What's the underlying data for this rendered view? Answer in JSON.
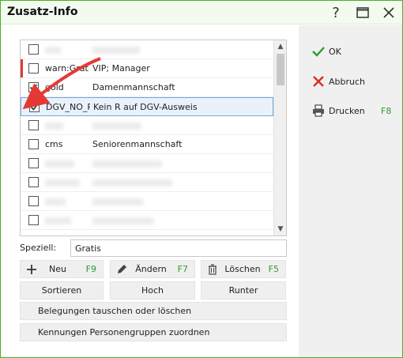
{
  "window": {
    "title": "Zusatz-Info",
    "title_buttons": [
      {
        "name": "help-icon",
        "glyph": "?"
      },
      {
        "name": "maximize-icon",
        "glyph": "☐"
      },
      {
        "name": "close-icon",
        "glyph": "✕"
      }
    ]
  },
  "list": {
    "rows": [
      {
        "checked": false,
        "code": "",
        "desc": "",
        "blurred": true
      },
      {
        "checked": false,
        "code": "warn:Gratis",
        "desc": "VIP; Manager",
        "blurred": false,
        "redmark": true
      },
      {
        "checked": true,
        "code": "gold",
        "desc": "Damenmannschaft",
        "blurred": false
      },
      {
        "checked": true,
        "code": "DGV_NO_R",
        "desc": "Kein R auf DGV-Ausweis",
        "blurred": false,
        "selected": true
      },
      {
        "checked": false,
        "code": "",
        "desc": "",
        "blurred": true
      },
      {
        "checked": false,
        "code": "cms",
        "desc": "Seniorenmannschaft",
        "blurred": false
      },
      {
        "checked": false,
        "code": "",
        "desc": "",
        "blurred": true
      },
      {
        "checked": false,
        "code": "",
        "desc": "",
        "blurred": true
      },
      {
        "checked": false,
        "code": "",
        "desc": "",
        "blurred": true
      },
      {
        "checked": false,
        "code": "",
        "desc": "",
        "blurred": true
      }
    ]
  },
  "speziell": {
    "label": "Speziell:",
    "value": "Gratis"
  },
  "buttons": {
    "neu": {
      "label": "Neu",
      "key": "F9"
    },
    "aendern": {
      "label": "Ändern",
      "key": "F7"
    },
    "loeschen": {
      "label": "Löschen",
      "key": "F5"
    },
    "sortieren": {
      "label": "Sortieren"
    },
    "hoch": {
      "label": "Hoch"
    },
    "runter": {
      "label": "Runter"
    },
    "belegungen": {
      "label": "Belegungen tauschen oder löschen"
    },
    "kennungen": {
      "label": "Kennungen Personengruppen zuordnen"
    }
  },
  "right": {
    "ok": {
      "label": "OK"
    },
    "abbruch": {
      "label": "Abbruch"
    },
    "drucken": {
      "label": "Drucken",
      "key": "F8"
    }
  },
  "colors": {
    "accent": "#4caf2a",
    "key_green": "#2e9b2e",
    "annotation_red": "#e53935",
    "selection_border": "#6ea8dc"
  }
}
